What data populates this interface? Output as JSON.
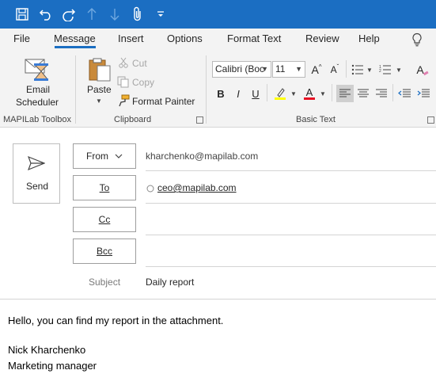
{
  "quick_access": {
    "icons": [
      "save-icon",
      "undo-icon",
      "redo-icon",
      "up-arrow-icon",
      "down-arrow-icon",
      "attach-icon",
      "customize-icon"
    ]
  },
  "tabs": [
    {
      "label": "File"
    },
    {
      "label": "Message",
      "active": true
    },
    {
      "label": "Insert"
    },
    {
      "label": "Options"
    },
    {
      "label": "Format Text"
    },
    {
      "label": "Review"
    },
    {
      "label": "Help"
    }
  ],
  "ribbon": {
    "mapilab": {
      "group_label": "MAPILab Toolbox",
      "email_scheduler_line1": "Email",
      "email_scheduler_line2": "Scheduler"
    },
    "clipboard": {
      "group_label": "Clipboard",
      "paste": "Paste",
      "cut": "Cut",
      "copy": "Copy",
      "format_painter": "Format Painter"
    },
    "basic_text": {
      "group_label": "Basic Text",
      "font_name": "Calibri (Boc",
      "font_size": "11",
      "bold": "B",
      "italic": "I",
      "underline": "U",
      "grow_font": "A",
      "shrink_font": "A",
      "font_color": "A",
      "clear_format": "A",
      "highlight_color": "#ffff00",
      "font_color_value": "#e81123"
    }
  },
  "compose": {
    "send_label": "Send",
    "from_label": "From",
    "from_value": "kharchenko@mapilab.com",
    "to_label": "To",
    "to_value": "ceo@mapilab.com",
    "cc_label": "Cc",
    "bcc_label": "Bcc",
    "subject_label": "Subject",
    "subject_value": "Daily report"
  },
  "body": {
    "line1": "Hello, you can find my report in the attachment.",
    "line2": "Nick Kharchenko",
    "line3": "Marketing manager"
  },
  "colors": {
    "titlebar": "#1b6ec2",
    "ribbon_bg": "#f3f3f3"
  }
}
